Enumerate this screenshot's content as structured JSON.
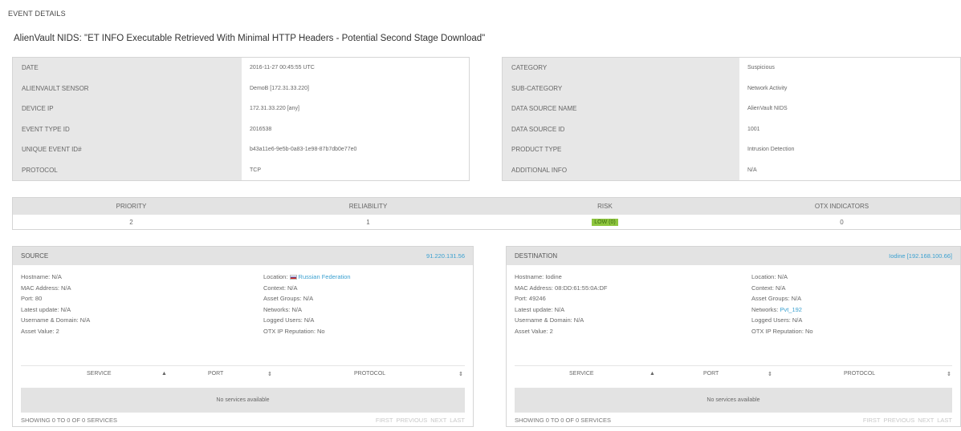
{
  "page": {
    "section_title": "EVENT DETAILS",
    "event_name": "AlienVault NIDS: \"ET INFO Executable Retrieved With Minimal HTTP Headers - Potential Second Stage Download\""
  },
  "details_left": [
    {
      "label": "DATE",
      "value": "2016-11-27 00:45:55 UTC"
    },
    {
      "label": "ALIENVAULT SENSOR",
      "value": "DemoB [172.31.33.220]"
    },
    {
      "label": "DEVICE IP",
      "value": "172.31.33.220 [any]"
    },
    {
      "label": "EVENT TYPE ID",
      "value": "2016538"
    },
    {
      "label": "UNIQUE EVENT ID#",
      "value": "b43a11e6-9e5b-0a83-1e98-87b7db0e77e0"
    },
    {
      "label": "PROTOCOL",
      "value": "TCP"
    }
  ],
  "details_right": [
    {
      "label": "CATEGORY",
      "value": "Suspicious"
    },
    {
      "label": "SUB-CATEGORY",
      "value": "Network Activity"
    },
    {
      "label": "DATA SOURCE NAME",
      "value": "AlienVault NIDS"
    },
    {
      "label": "DATA SOURCE ID",
      "value": "1001"
    },
    {
      "label": "PRODUCT TYPE",
      "value": "Intrusion Detection"
    },
    {
      "label": "ADDITIONAL INFO",
      "value": "N/A"
    }
  ],
  "metrics": {
    "priority_label": "PRIORITY",
    "priority_value": "2",
    "reliability_label": "RELIABILITY",
    "reliability_value": "1",
    "risk_label": "RISK",
    "risk_value": "LOW (0)",
    "otx_label": "OTX INDICATORS",
    "otx_value": "0",
    "risk_color": "#8ec63f"
  },
  "source": {
    "title": "SOURCE",
    "ip": "91.220.131.56",
    "hostname": "Hostname: N/A",
    "mac": "MAC Address: N/A",
    "port": "Port: 80",
    "latest_update": "Latest update: N/A",
    "username": "Username & Domain: N/A",
    "asset_value": "Asset Value: 2",
    "location_label": "Location:",
    "location_value": "Russian Federation",
    "context": "Context: N/A",
    "asset_groups": "Asset Groups: N/A",
    "networks_label": "Networks:",
    "networks_value": "N/A",
    "logged_users": "Logged Users: N/A",
    "otx_rep": "OTX IP Reputation: No",
    "col_service": "SERVICE",
    "col_port": "PORT",
    "col_protocol": "PROTOCOL",
    "empty": "No services available",
    "count": "SHOWING 0 TO 0 OF 0 SERVICES",
    "pager": "FIRST PREVIOUS NEXT LAST"
  },
  "destination": {
    "title": "DESTINATION",
    "ip": "Iodine [192.168.100.66]",
    "hostname": "Hostname: Iodine",
    "mac": "MAC Address: 08:DD:61:55:0A:DF",
    "port": "Port: 49246",
    "latest_update": "Latest update: N/A",
    "username": "Username & Domain: N/A",
    "asset_value": "Asset Value: 2",
    "location_label": "Location: N/A",
    "context": "Context: N/A",
    "asset_groups": "Asset Groups: N/A",
    "networks_label": "Networks:",
    "networks_value": "Pvt_192",
    "logged_users": "Logged Users: N/A",
    "otx_rep": "OTX IP Reputation: No",
    "col_service": "SERVICE",
    "col_port": "PORT",
    "col_protocol": "PROTOCOL",
    "empty": "No services available",
    "count": "SHOWING 0 TO 0 OF 0 SERVICES",
    "pager": "FIRST PREVIOUS NEXT LAST"
  },
  "icons": {
    "sort_asc": "triangle-up-icon",
    "sort_both": "sort-icon",
    "flag": "russia-flag-icon"
  }
}
